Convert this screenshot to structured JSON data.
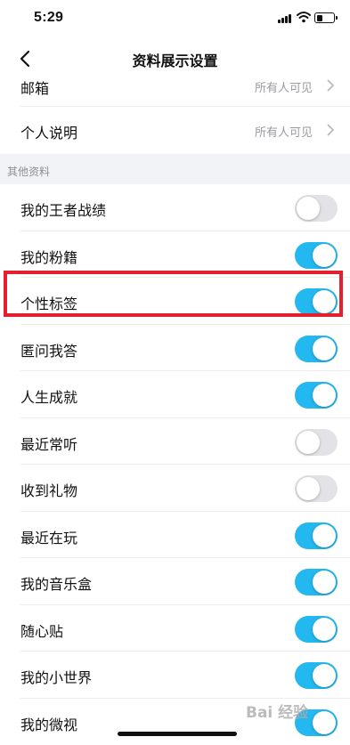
{
  "status_bar": {
    "time": "5:29"
  },
  "nav": {
    "title": "资料展示设置"
  },
  "top_rows": [
    {
      "label": "邮箱",
      "value": "所有人可见"
    },
    {
      "label": "个人说明",
      "value": "所有人可见"
    }
  ],
  "section": {
    "title": "其他资料"
  },
  "toggles": [
    {
      "label": "我的王者战绩",
      "on": false
    },
    {
      "label": "我的粉籍",
      "on": true
    },
    {
      "label": "个性标签",
      "on": true
    },
    {
      "label": "匿问我答",
      "on": true
    },
    {
      "label": "人生成就",
      "on": true
    },
    {
      "label": "最近常听",
      "on": false
    },
    {
      "label": "收到礼物",
      "on": false
    },
    {
      "label": "最近在玩",
      "on": true
    },
    {
      "label": "我的音乐盒",
      "on": true
    },
    {
      "label": "随心贴",
      "on": true
    },
    {
      "label": "我的小世界",
      "on": true
    },
    {
      "label": "我的微视",
      "on": true
    }
  ],
  "watermark": {
    "text": "Bai 经验"
  },
  "colors": {
    "toggle_on": "#23b8f0",
    "toggle_off": "#e3e3e7",
    "highlight": "#e5202e"
  }
}
